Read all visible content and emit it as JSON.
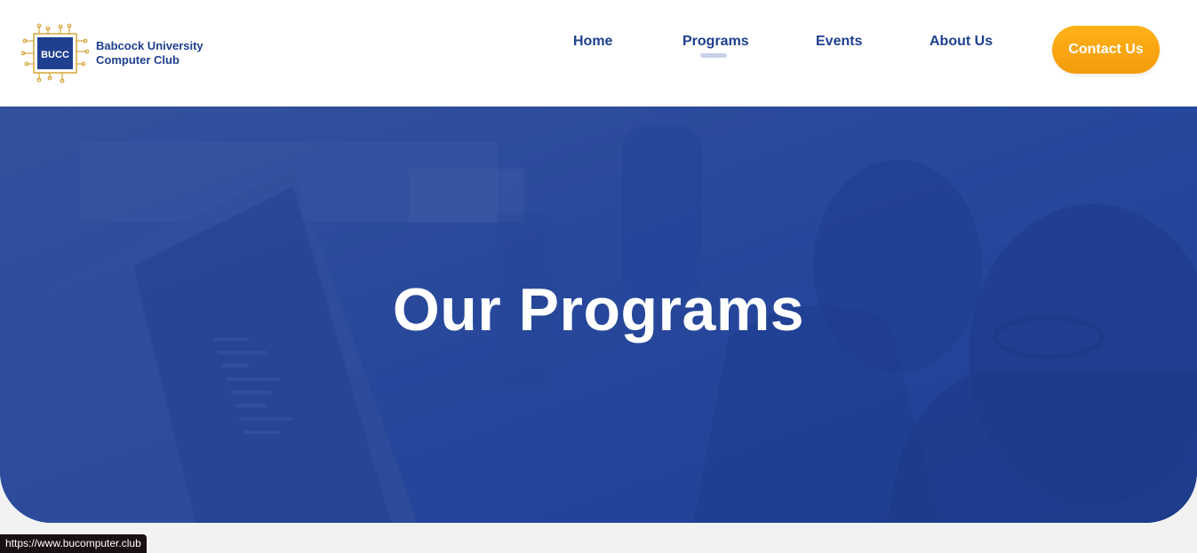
{
  "brand": {
    "logo_label": "BUCC",
    "name_line1": "Babcock University",
    "name_line2": "Computer Club"
  },
  "nav": {
    "items": [
      {
        "label": "Home",
        "active": false
      },
      {
        "label": "Programs",
        "active": true
      },
      {
        "label": "Events",
        "active": false
      },
      {
        "label": "About Us",
        "active": false
      }
    ],
    "cta_label": "Contact Us"
  },
  "hero": {
    "title": "Our Programs"
  },
  "status_bar": {
    "url": "https://www.bucomputer.club"
  },
  "colors": {
    "brand_blue": "#1f3f8f",
    "hero_blue": "#2a4fa3",
    "cta_orange": "#f9a30e",
    "logo_gold": "#d6a63a"
  }
}
